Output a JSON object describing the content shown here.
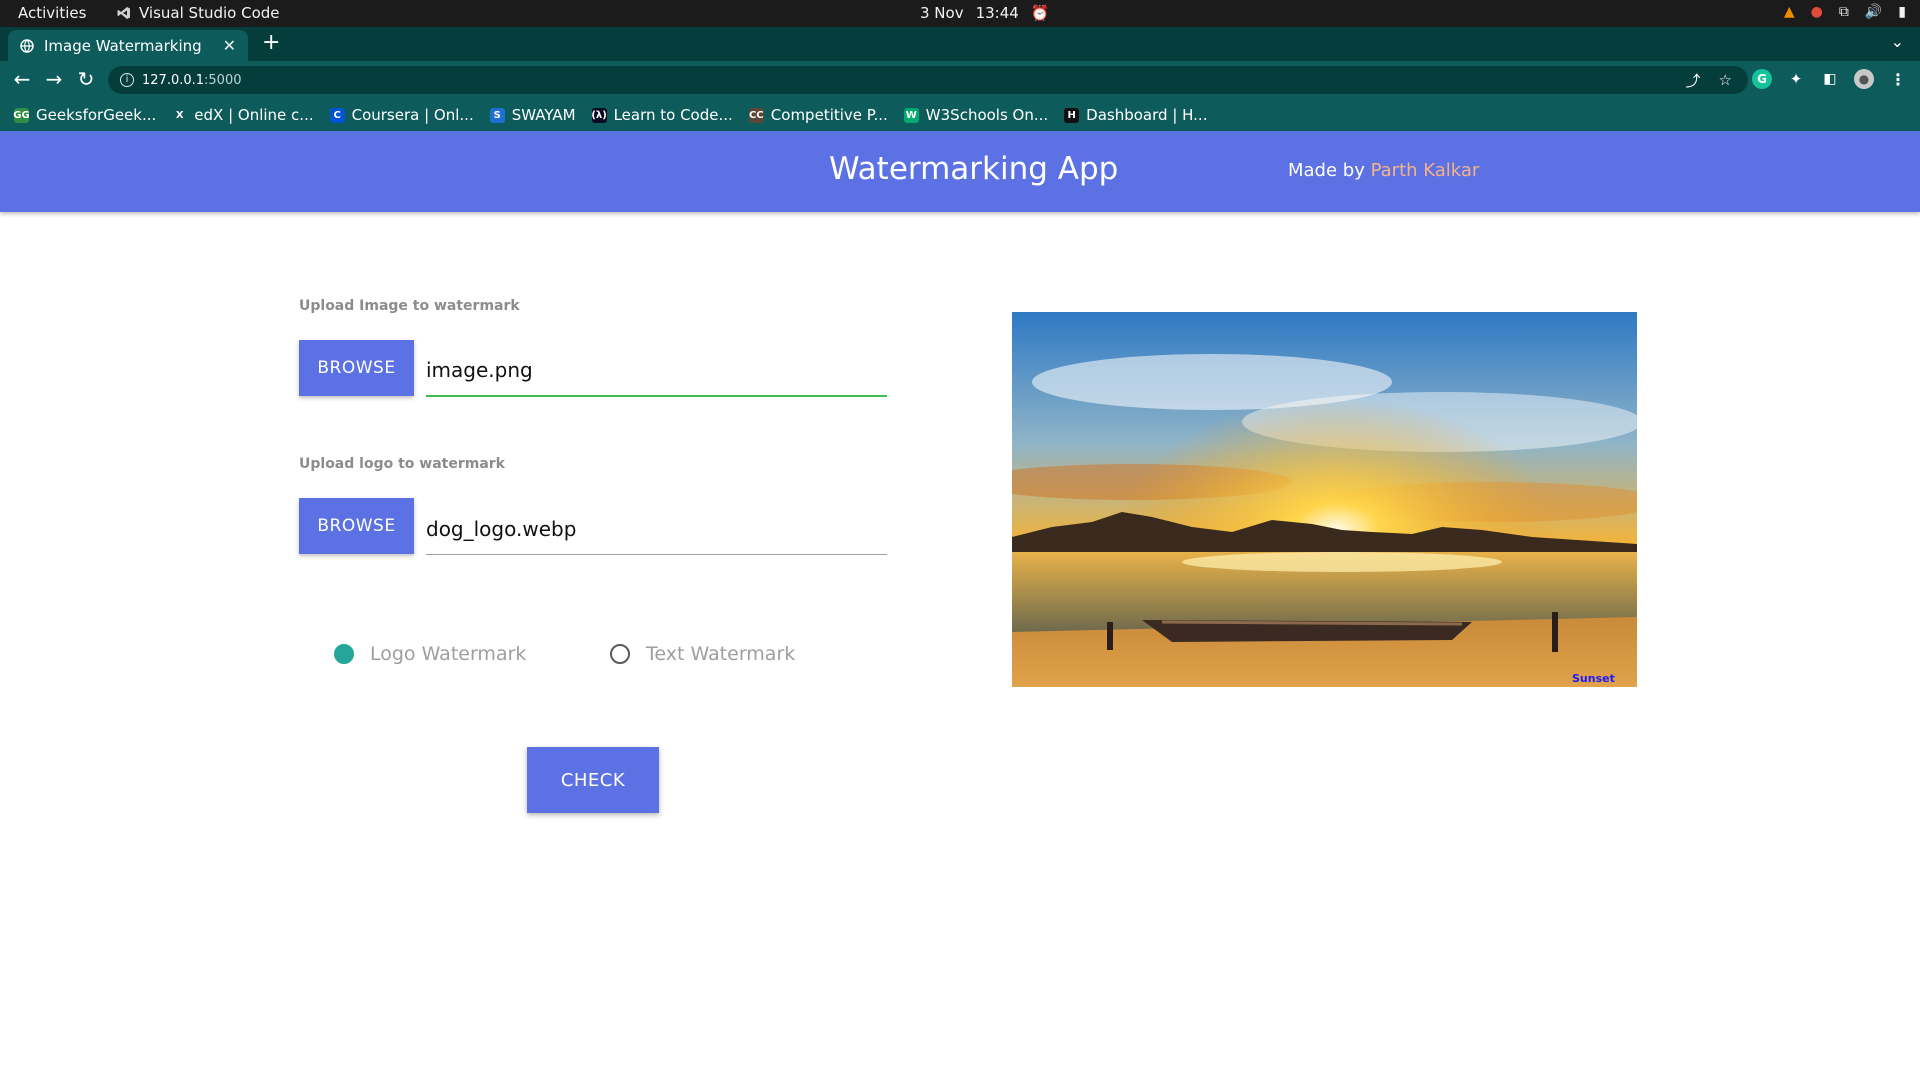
{
  "os_bar": {
    "activities": "Activities",
    "app_name": "Visual Studio Code",
    "date": "3 Nov",
    "time": "13:44"
  },
  "browser": {
    "tab_title": "Image Watermarking",
    "new_tab": "+",
    "url_host": "127.0.0.1",
    "url_port": ":5000",
    "bookmarks": [
      {
        "label": "GeeksforGeek...",
        "icon": "gfg-icon",
        "color": "#2f8d46",
        "glyph": "GG"
      },
      {
        "label": "edX | Online c...",
        "icon": "edx-icon",
        "color": "#0d5b5b",
        "glyph": "X"
      },
      {
        "label": "Coursera | Onl...",
        "icon": "coursera-icon",
        "color": "#0056d2",
        "glyph": "C"
      },
      {
        "label": "SWAYAM",
        "icon": "swayam-icon",
        "color": "#1f6fd1",
        "glyph": "S"
      },
      {
        "label": "Learn to Code...",
        "icon": "freecodecamp-icon",
        "color": "#0a0a23",
        "glyph": "(λ)"
      },
      {
        "label": "Competitive P...",
        "icon": "codechef-icon",
        "color": "#5b4638",
        "glyph": "CC"
      },
      {
        "label": "W3Schools On...",
        "icon": "w3schools-icon",
        "color": "#04aa6d",
        "glyph": "W"
      },
      {
        "label": "Dashboard | H...",
        "icon": "hackerrank-icon",
        "color": "#111111",
        "glyph": "H"
      }
    ]
  },
  "header": {
    "title": "Watermarking App",
    "made_by_prefix": "Made by ",
    "author": "Parth Kalkar"
  },
  "form": {
    "image_label": "Upload Image to watermark",
    "image_button": "BROWSE",
    "image_file": "image.png",
    "logo_label": "Upload logo to watermark",
    "logo_button": "BROWSE",
    "logo_file": "dog_logo.webp",
    "radio_logo": "Logo Watermark",
    "radio_text": "Text Watermark",
    "selected_mode": "Logo Watermark",
    "check_button": "CHECK"
  },
  "preview": {
    "description_icon": "sunset-boat-image",
    "watermark_text": "Sunset"
  },
  "colors": {
    "accent": "#5c71e3",
    "author": "#f6b287",
    "radio_checked": "#26a69a",
    "input_active": "#3ebd50"
  }
}
